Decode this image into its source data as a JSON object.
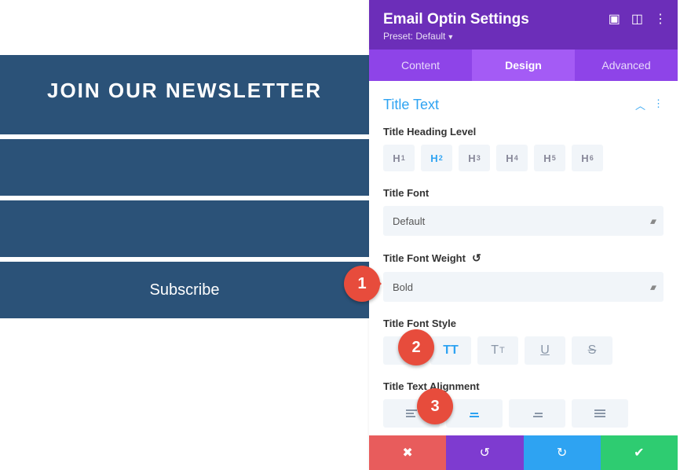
{
  "preview": {
    "title": "JOIN OUR NEWSLETTER",
    "subscribe": "Subscribe"
  },
  "panel": {
    "title": "Email Optin Settings",
    "preset_prefix": "Preset:",
    "preset_value": "Default"
  },
  "tabs": {
    "content": "Content",
    "design": "Design",
    "advanced": "Advanced"
  },
  "section": {
    "title": "Title Text"
  },
  "fields": {
    "heading_level": {
      "label": "Title Heading Level",
      "options": [
        "H1",
        "H2",
        "H3",
        "H4",
        "H5",
        "H6"
      ],
      "active": "H2"
    },
    "font": {
      "label": "Title Font",
      "value": "Default"
    },
    "font_weight": {
      "label": "Title Font Weight",
      "value": "Bold"
    },
    "font_style": {
      "label": "Title Font Style"
    },
    "text_alignment": {
      "label": "Title Text Alignment"
    }
  },
  "callouts": {
    "c1": "1",
    "c2": "2",
    "c3": "3"
  }
}
